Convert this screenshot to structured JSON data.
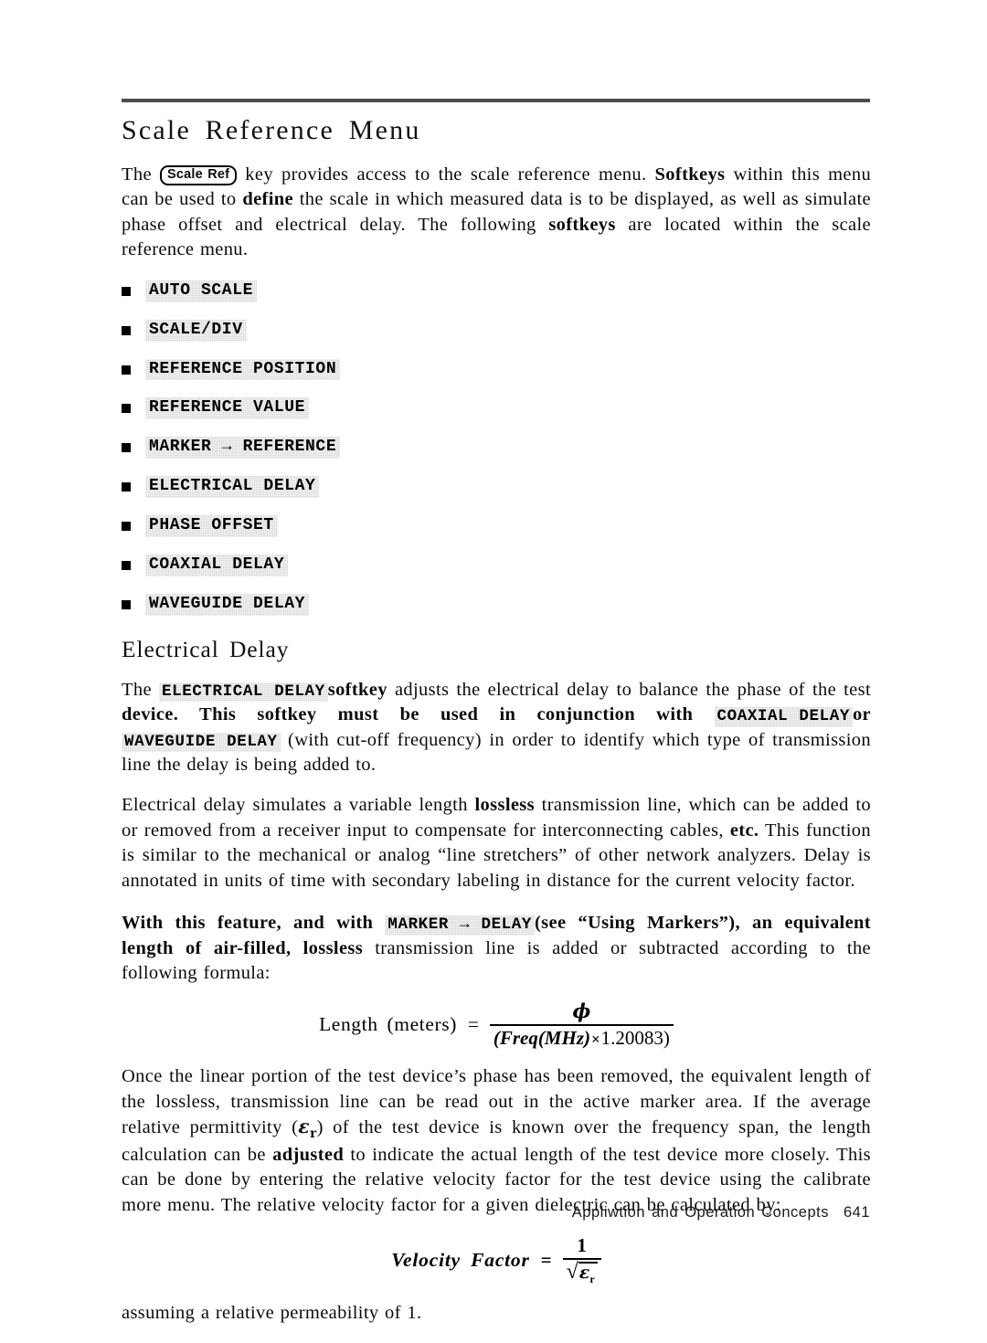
{
  "document": {
    "heading": "Scale Reference Menu",
    "section_heading": "Electrical Delay"
  },
  "intro": {
    "lead": "The",
    "hardkey": "Scale Ref",
    "after_key": "key provides access to the scale reference menu.",
    "bold_softkeys": "Softkeys",
    "rest_1": "within this menu can be used to",
    "bold_define": "define",
    "rest_2": "the scale in which measured data is to be displayed, as well as simulate phase offset and electrical delay. The following",
    "bold_softkeys_2": "softkeys",
    "rest_3": "are located within the scale reference menu."
  },
  "softkey_list": [
    {
      "label": "AUTO SCALE"
    },
    {
      "label": "SCALE/DIV"
    },
    {
      "label": "REFERENCE POSITION"
    },
    {
      "label": "REFERENCE VALUE"
    },
    {
      "label": "MARKER → REFERENCE"
    },
    {
      "label": "ELECTRICAL DELAY"
    },
    {
      "label": "PHASE OFFSET"
    },
    {
      "label": "COAXIAL DELAY"
    },
    {
      "label": "WAVEGUIDE DELAY"
    }
  ],
  "electrical_delay": {
    "p1_a": "The",
    "p1_softkey_electrical": "ELECTRICAL DELAY",
    "p1_b": "softkey",
    "p1_c": "adjusts the electrical delay to balance the phase of the test",
    "p1_bold_d": "device. This softkey must be used in conjunction with",
    "p1_softkey_coaxial": "COAXIAL DELAY",
    "p1_bold_or": "or",
    "p1_softkey_waveguide": "WAVEGUIDE DELAY",
    "p1_e": "(with cut-off frequency) in order to identify which type of transmission line the delay is being added to.",
    "p2_a": "Electrical delay simulates a variable length",
    "p2_bold_lossless": "lossless",
    "p2_b": "transmission line, which can be added to or removed from a receiver input to compensate for interconnecting cables,",
    "p2_bold_etc": "etc.",
    "p2_c": "This function is similar to the mechanical or analog “line stretchers” of other network analyzers. Delay is annotated in units of time with secondary labeling in distance for the current velocity factor.",
    "p3_bold_a": "With this feature, and with",
    "p3_softkey_marker": "MARKER → DELAY",
    "p3_bold_b": "(see “Using Markers”), an equivalent length of",
    "p3_bold_c": "air-filled, lossless",
    "p3_d": "transmission line is added or subtracted according to the following formula:",
    "p4_a": "Once the linear portion of the test device’s phase has been removed, the equivalent length of the lossless, transmission line can be read out in the active marker area. If the average relative permittivity (",
    "p4_eps": "ε",
    "p4_eps_sub": "r",
    "p4_b": ") of the test device is known over the frequency span, the length calculation can be",
    "p4_bold_adjusted": "adjusted",
    "p4_c": "to indicate the actual length of the test device more closely. This can be done by entering the relative velocity factor for the test device using the calibrate more menu. The relative velocity factor for a given dielectric can be calculated by:",
    "p5": "assuming a relative permeability of 1."
  },
  "formulas": {
    "length": {
      "label": "Length (meters)",
      "equals": "=",
      "numerator": "ϕ",
      "denominator_open": "(",
      "denominator_freq": "Freq",
      "denominator_mhz": "(MHz)",
      "denominator_times": "×",
      "denominator_value": "1.20083",
      "denominator_close": ")"
    },
    "velocity": {
      "label": "Velocity Factor",
      "equals": "=",
      "numerator": "1",
      "radical": "√",
      "radicand": "ε",
      "radicand_sub": "r"
    }
  },
  "footer": {
    "text": "Appliwtion and Operation Concepts",
    "page_number": "641"
  }
}
